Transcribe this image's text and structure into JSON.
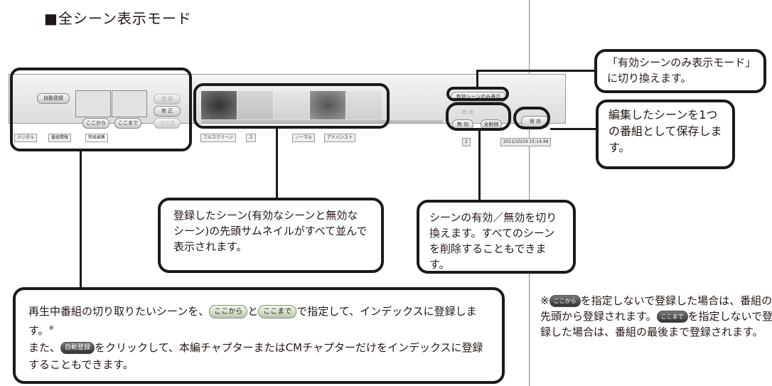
{
  "title": "■全シーン表示モード",
  "toolbar": {
    "auto_register": "自動登録",
    "register": "登 録",
    "fix": "修 正",
    "clear": "クリア",
    "from_here": "ここから",
    "to_here": "ここまで",
    "tabs": [
      "デジタル",
      "番組情報",
      "簡易編集"
    ],
    "view_buttons": [
      "フルスクリーン",
      "ス",
      "ノーマル",
      "アドバンスト"
    ],
    "valid_only_mode": "有効シーンのみ表示",
    "valid": "有 効",
    "invalid": "無 効",
    "delete_all": "全削除",
    "save": "保 存",
    "datetime": "2011/10/19 15:14:48",
    "status_abbrev": "2"
  },
  "callouts": {
    "valid_only": "「有効シーンのみ表示モード」に切り換えます。",
    "save": "編集したシーンを1つの番組として保存します。",
    "thumbnails": "登録したシーン(有効なシーンと無効なシーン)の先頭サムネイルがすべて並んで表示されます。",
    "toggle": "シーンの有効／無効を切り換えます。すべてのシーンを削除することもできます。",
    "bottom_p1": "再生中番組の切り取りたいシーンを、",
    "bottom_and": "と",
    "bottom_p2": "で指定して、インデックスに登録します。",
    "bottom_mark": "※",
    "bottom_p3": "また、",
    "bottom_p4": "をクリックして、本編チャプターまたはCMチャプターだけをインデックスに登録することもできます。"
  },
  "note": {
    "mark": "※",
    "p1": "を指定しないで登録した場合は、番組の先頭から登録されます。",
    "p2": "を指定しないで登録した場合は、番組の最後まで登録されます。"
  }
}
